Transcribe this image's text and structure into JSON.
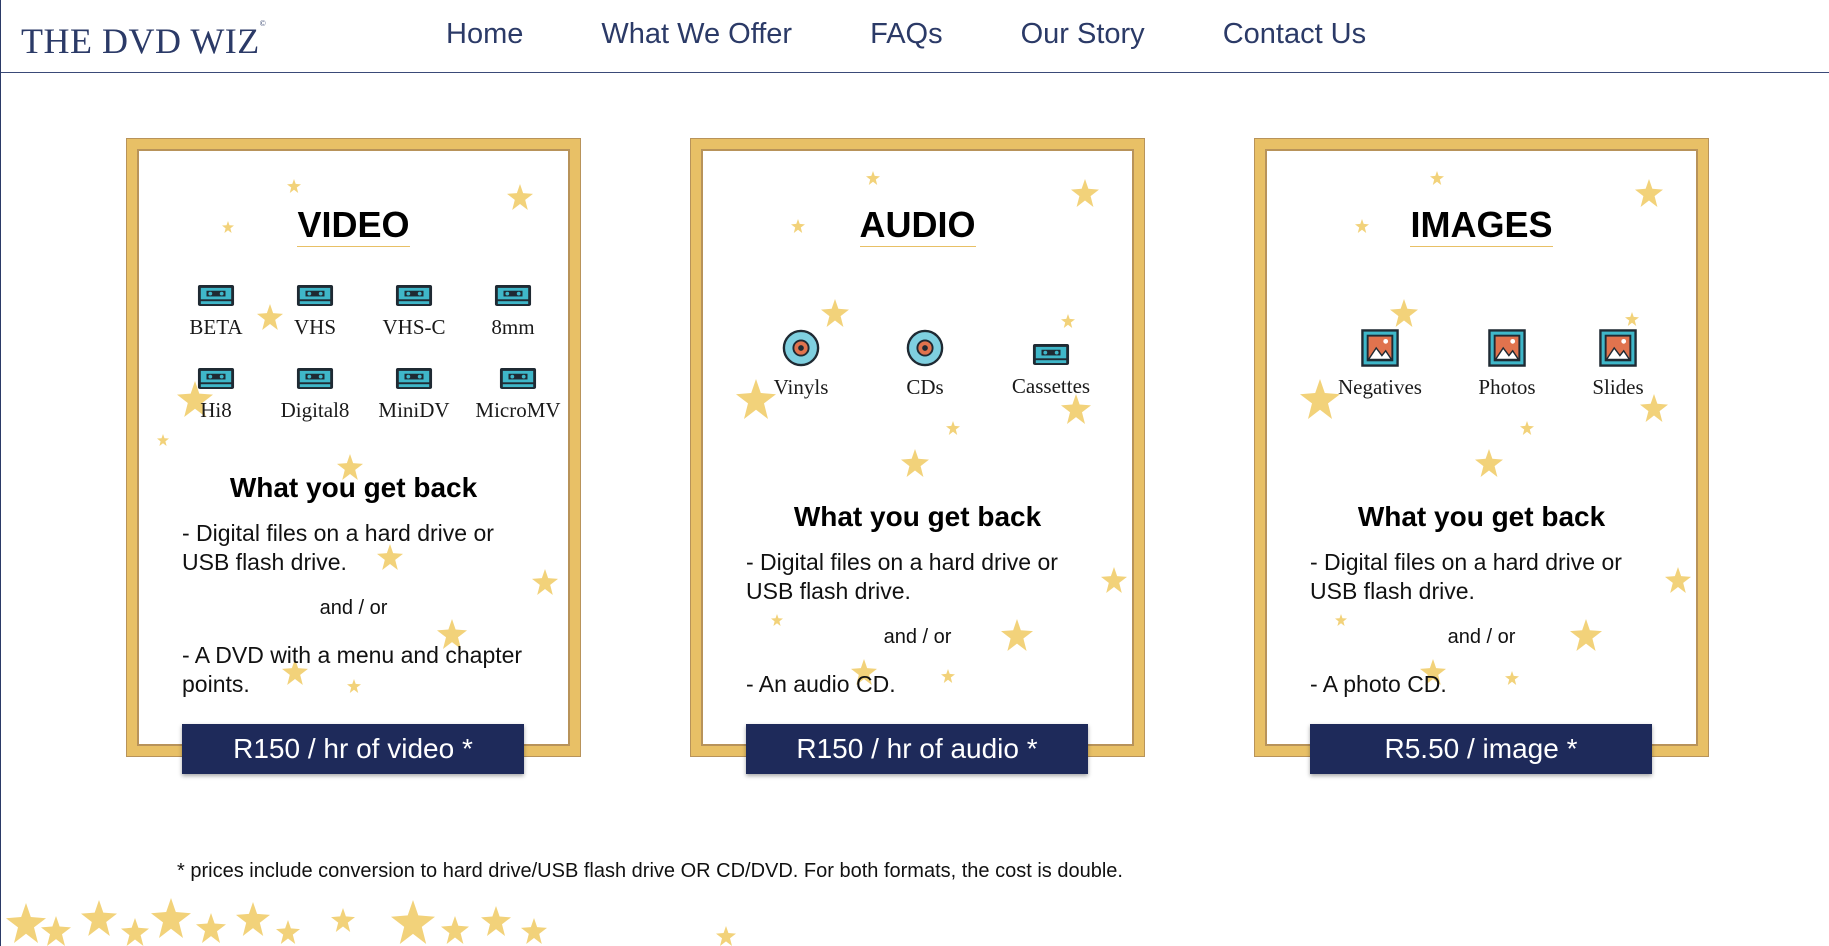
{
  "header": {
    "logo": "THE DVD WIZ",
    "logo_mark": "©",
    "nav": [
      "Home",
      "What We Offer",
      "FAQs",
      "Our Story",
      "Contact Us"
    ]
  },
  "cards": [
    {
      "title": "VIDEO",
      "formats": [
        {
          "label": "BETA",
          "icon": "cassette-icon"
        },
        {
          "label": "VHS",
          "icon": "cassette-icon"
        },
        {
          "label": "VHS-C",
          "icon": "cassette-icon"
        },
        {
          "label": "8mm",
          "icon": "cassette-icon"
        },
        {
          "label": "Hi8",
          "icon": "cassette-icon"
        },
        {
          "label": "Digital8",
          "icon": "cassette-icon"
        },
        {
          "label": "MiniDV",
          "icon": "cassette-icon"
        },
        {
          "label": "MicroMV",
          "icon": "cassette-icon"
        }
      ],
      "what_back_title": "What you get back",
      "item1": "- Digital files on a hard drive or USB flash drive.",
      "and_or": "and / or",
      "item2": "- A DVD with a menu and chapter points.",
      "price": "R150 / hr of video *"
    },
    {
      "title": "AUDIO",
      "formats": [
        {
          "label": "Vinyls",
          "icon": "disc-icon"
        },
        {
          "label": "CDs",
          "icon": "disc-icon"
        },
        {
          "label": "Cassettes",
          "icon": "cassette-icon"
        }
      ],
      "what_back_title": "What you get back",
      "item1": "- Digital files on a hard drive or USB flash drive.",
      "and_or": "and / or",
      "item2": "- An audio CD.",
      "price": "R150 / hr of audio *"
    },
    {
      "title": "IMAGES",
      "formats": [
        {
          "label": "Negatives",
          "icon": "picture-icon"
        },
        {
          "label": "Photos",
          "icon": "picture-icon"
        },
        {
          "label": "Slides",
          "icon": "picture-icon"
        }
      ],
      "what_back_title": "What you get back",
      "item1": "- Digital files on a hard drive or USB flash drive.",
      "and_or": "and / or",
      "item2": "- A photo CD.",
      "price": "R5.50 / image *"
    }
  ],
  "footnote": "* prices include conversion to hard drive/USB flash drive OR CD/DVD. For both formats, the cost is double.",
  "colors": {
    "navy": "#1e2a5a",
    "nav_text": "#2b3a67",
    "gold_frame": "#e8c066",
    "star": "#f2d27a",
    "icon_teal": "#3fb7c9"
  }
}
